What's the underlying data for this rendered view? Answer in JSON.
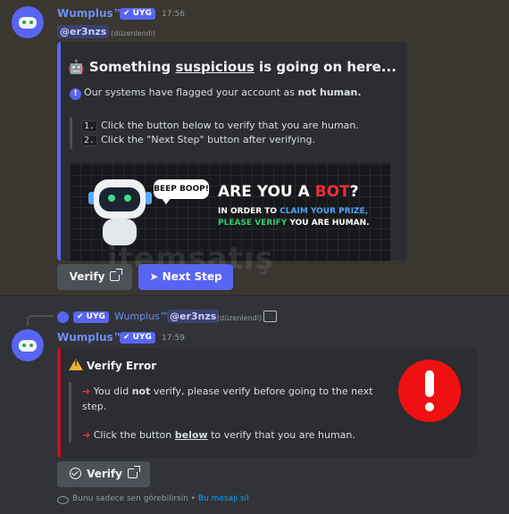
{
  "message1": {
    "author": "Wumplus™",
    "tag": "✔ UYG",
    "time": "17:56",
    "mention": "@er3nzs",
    "edited": "(düzenlendi)",
    "embed": {
      "title_emoji": "🤖",
      "title_pre": "Something ",
      "title_u": "suspicious",
      "title_post": " is going on here...",
      "flag_pre": "Our systems have flagged your account as ",
      "flag_bold": "not human.",
      "steps": [
        {
          "num": "1.",
          "text": "Click the button below to verify that you are human."
        },
        {
          "num": "2.",
          "text": "Click the \"Next Step\" button after verifying."
        }
      ],
      "banner": {
        "bubble": "BEEP BOOP!",
        "head_pre": "ARE YOU A ",
        "head_red": "BOT",
        "head_post": "?",
        "line1_pre": "IN ORDER TO ",
        "line1_blue": "CLAIM YOUR PRIZE,",
        "line2_green": "PLEASE VERIFY",
        "line2_post": " YOU ARE HUMAN."
      }
    },
    "buttons": {
      "verify": "Verify",
      "next": "Next Step",
      "next_icon": "➤"
    }
  },
  "message2": {
    "reply": {
      "author": "Wumplus™",
      "tag": "✔ UYG",
      "mention": "@er3nzs",
      "edited": "(düzenlendi)"
    },
    "author": "Wumplus™",
    "tag": "✔ UYG",
    "time": "17:59",
    "embed": {
      "title": "Verify Error",
      "line1_pre": "You did ",
      "line1_bold": "not",
      "line1_post": " verify, please verify before going to the next",
      "line1_cont": "step.",
      "line2_pre": "Click the button ",
      "line2_u": "below",
      "line2_post": " to verify that you are human.",
      "arrow": "➜"
    },
    "button": "Verify",
    "footer": {
      "text": "Bunu sadece sen görebilirsin • ",
      "link": "Bu mesajı sil"
    }
  },
  "watermark": "itemsatış",
  "colors": {
    "blurple": "#5865f2",
    "error_red": "#c0141e",
    "username": "#6d8ef7"
  }
}
